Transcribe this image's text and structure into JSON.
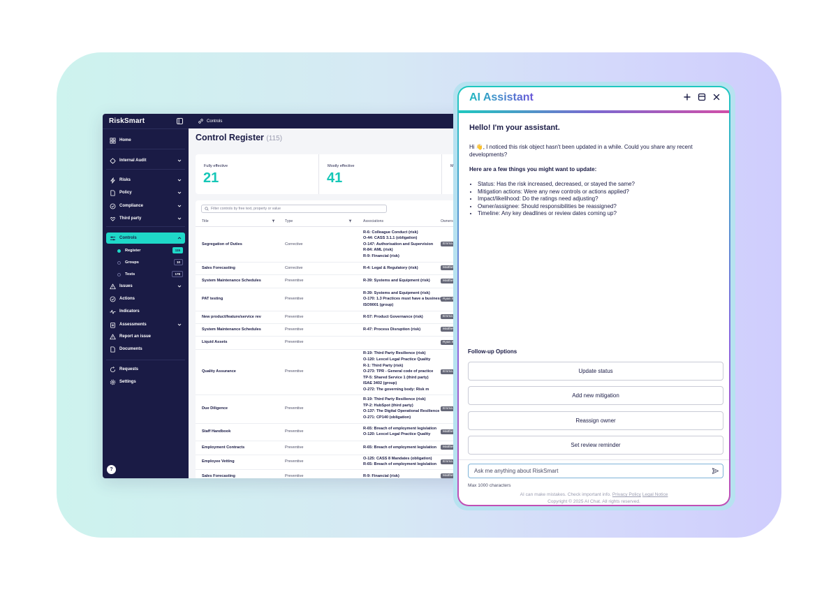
{
  "app": {
    "logo": "RiskSmart",
    "breadcrumb": "Controls",
    "page_title": "Control Register",
    "page_count": "(115)",
    "nav": [
      {
        "label": "Home",
        "icon": "home-icon",
        "chevron": false
      },
      {
        "label": "Internal Audit",
        "icon": "audit-icon",
        "chevron": true
      },
      {
        "label": "Risks",
        "icon": "lightning-icon",
        "chevron": true
      },
      {
        "label": "Policy",
        "icon": "document-icon",
        "chevron": true
      },
      {
        "label": "Compliance",
        "icon": "check-circle-icon",
        "chevron": true
      },
      {
        "label": "Third party",
        "icon": "handshake-icon",
        "chevron": true
      },
      {
        "label": "Controls",
        "icon": "sliders-icon",
        "chevron": true,
        "active": true
      },
      {
        "label": "Issues",
        "icon": "warning-icon",
        "chevron": true
      },
      {
        "label": "Actions",
        "icon": "check-circle-icon",
        "chevron": false
      },
      {
        "label": "Indicators",
        "icon": "pulse-icon",
        "chevron": false
      },
      {
        "label": "Assessments",
        "icon": "clipboard-icon",
        "chevron": true
      },
      {
        "label": "Report an issue",
        "icon": "warning-icon",
        "chevron": false
      },
      {
        "label": "Documents",
        "icon": "document-icon",
        "chevron": false
      },
      {
        "label": "Requests",
        "icon": "request-icon",
        "chevron": false
      },
      {
        "label": "Settings",
        "icon": "gear-icon",
        "chevron": false
      }
    ],
    "sub_nav": [
      {
        "label": "Register",
        "count": "115"
      },
      {
        "label": "Groups",
        "count": "10"
      },
      {
        "label": "Tests",
        "count": "178"
      }
    ],
    "help_label": "?",
    "stats": [
      {
        "label": "Fully effective",
        "value": "21"
      },
      {
        "label": "Mostly effective",
        "value": "41"
      },
      {
        "label": "Mo",
        "value": ""
      }
    ],
    "search_placeholder": "Filter controls by free text, property or value",
    "columns": [
      "Title",
      "Type",
      "Associations",
      "Owners"
    ],
    "rows": [
      {
        "title": "Segregation of Duties",
        "type": "Corrective",
        "assoc": [
          "R-6: Colleague Conduct (risk)",
          "O-44: CASS 3.1.1 (obligation)",
          "O-147: Authorisation and Supervision",
          "R-84: AML (risk)",
          "R-9: Financial (risk)"
        ],
        "owner": "Emma Stone"
      },
      {
        "title": "Sales Forecasting",
        "type": "Corrective",
        "assoc": [
          "R-4: Legal & Regulatory (risk)"
        ],
        "owner": "Matthew"
      },
      {
        "title": "System Maintenance Schedules",
        "type": "Preventive",
        "assoc": [
          "R-39: Systems and Equipment (risk)"
        ],
        "owner": "Matthew"
      },
      {
        "title": "PAT testing",
        "type": "Preventive",
        "assoc": [
          "R-39: Systems and Equipment (risk)",
          "O-170: 1.3 Practices must have a business",
          "ISO9001 (group)"
        ],
        "owner": "Ryan Sw"
      },
      {
        "title": "New product/feature/service rev",
        "type": "Preventive",
        "assoc": [
          "R-57: Product Governance (risk)"
        ],
        "owner": "Emma St"
      },
      {
        "title": "System Maintenance Schedules",
        "type": "Preventive",
        "assoc": [
          "R-47: Process Disruption (risk)"
        ],
        "owner": "Matthew"
      },
      {
        "title": "Liquid Assets",
        "type": "Preventive",
        "assoc": [],
        "owner": "Ryan Sw"
      },
      {
        "title": "Quality Assurance",
        "type": "Preventive",
        "assoc": [
          "R-19: Third Party Resilience (risk)",
          "O-120: Lexcel Legal Practice Quality",
          "R-1: Third Party (risk)",
          "O-273: TPR - General code of practice",
          "TP-5: Shared Service 1 (third party)",
          "ISAE 3402 (group)",
          "O-272: The governing body: Risk m"
        ],
        "owner": "Emma St"
      },
      {
        "title": "Due Diligence",
        "type": "Preventive",
        "assoc": [
          "R-19: Third Party Resilience (risk)",
          "TP-2: HubSpot (third party)",
          "O-137: The Digital Operational Resilience",
          "O-271: CP140 (obligation)"
        ],
        "owner": "Emma St"
      },
      {
        "title": "Staff Handbook",
        "type": "Preventive",
        "assoc": [
          "R-65: Breach of employment legislation",
          "O-120: Lexcel Legal Practice Quality"
        ],
        "owner": "Matthew"
      },
      {
        "title": "Employment Contracts",
        "type": "Preventive",
        "assoc": [
          "R-65: Breach of employment legislation"
        ],
        "owner": "Matthew"
      },
      {
        "title": "Employee Vetting",
        "type": "Preventive",
        "assoc": [
          "O-125: CASS 8 Mandates (obligation)",
          "R-65: Breach of employment legislation"
        ],
        "owner": "Emma St"
      },
      {
        "title": "Sales Forecasting",
        "type": "Preventive",
        "assoc": [
          "R-9: Financial (risk)"
        ],
        "owner": "Matthew"
      }
    ]
  },
  "assistant": {
    "title": "AI Assistant",
    "greeting": "Hello! I'm your assistant.",
    "intro": "Hi 👋, I noticed this risk object hasn't been updated in a while. Could you share any recent developments?",
    "subheading": "Here are a few things you might want to update:",
    "tips": [
      "Status: Has the risk increased, decreased, or stayed the same?",
      "Mitigation actions: Were any new controls or actions applied?",
      "Impact/likelihood: Do the ratings need adjusting?",
      "Owner/assignee: Should responsibilities be reassigned?",
      "Timeline: Any key deadlines or review dates coming up?"
    ],
    "followup_title": "Follow-up Options",
    "followups": [
      "Update status",
      "Add new mitigation",
      "Reassign owner",
      "Set review reminder"
    ],
    "input_placeholder": "Ask me anything about RiskSmart",
    "max_chars": "Max 1000 characters",
    "disclaimer": "AI can make mistakes. Check important info.",
    "privacy_link": "Privacy Policy",
    "legal_link": "Legal Notice",
    "copyright": "Copyright © 2025 AI Chat. All rights reserved."
  }
}
